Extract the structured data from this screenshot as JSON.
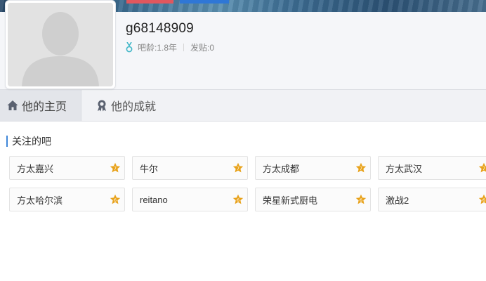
{
  "profile": {
    "username": "g68148909",
    "age_label": "吧龄:1.8年",
    "posts_label": "发贴:0"
  },
  "tabs": [
    {
      "label": "他的主页",
      "icon": "home-icon",
      "active": true
    },
    {
      "label": "他的成就",
      "icon": "achievement-icon",
      "active": false
    }
  ],
  "followed": {
    "title": "关注的吧",
    "bars": [
      {
        "name": "方太嘉兴",
        "level": "7"
      },
      {
        "name": "牛尔",
        "level": "7"
      },
      {
        "name": "方太成都",
        "level": "7"
      },
      {
        "name": "方太武汉",
        "level": "7"
      },
      {
        "name": "方太哈尔滨",
        "level": "6"
      },
      {
        "name": "reitano",
        "level": "6"
      },
      {
        "name": "荣星新式厨电",
        "level": "6"
      },
      {
        "name": "激战2",
        "level": "6"
      }
    ]
  },
  "colors": {
    "accent": "#3f86d8",
    "star": "#e8a21a",
    "medal": "#3fb6c7"
  }
}
